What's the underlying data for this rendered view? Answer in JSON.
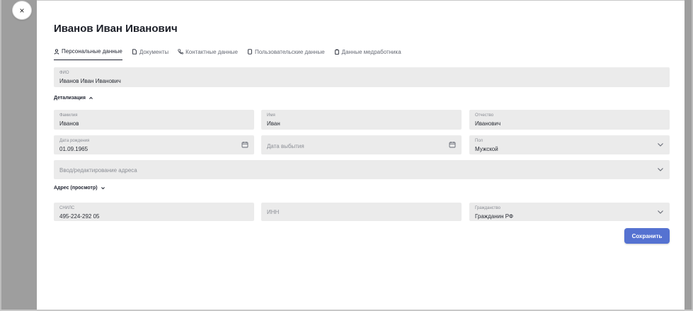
{
  "close_label": "×",
  "title": "Иванов Иван Иванович",
  "tabs": [
    {
      "label": "Персональные данные",
      "icon": "person-icon"
    },
    {
      "label": "Документы",
      "icon": "document-icon"
    },
    {
      "label": "Контактные данные",
      "icon": "phone-icon"
    },
    {
      "label": "Пользовательские данные",
      "icon": "page-icon"
    },
    {
      "label": "Данные медработника",
      "icon": "clipboard-icon"
    }
  ],
  "fio": {
    "label": "ФИО",
    "value": "Иванов Иван Иванович"
  },
  "detail_section": {
    "label": "Детализация",
    "icon": "chevron-up-icon"
  },
  "surname": {
    "label": "Фамилия",
    "value": "Иванов"
  },
  "name": {
    "label": "Имя",
    "value": "Иван"
  },
  "patronymic": {
    "label": "Отчество",
    "value": "Иванович"
  },
  "birth_date": {
    "label": "Дата рождения",
    "value": "01.09.1965",
    "icon": "calendar-icon"
  },
  "departure_date": {
    "placeholder": "Дата выбытия",
    "icon": "calendar-icon"
  },
  "gender": {
    "label": "Пол",
    "value": "Мужской",
    "icon": "chevron-down-icon"
  },
  "address_edit": {
    "placeholder": "Ввод/редактирование адреса",
    "icon": "chevron-down-icon"
  },
  "address_view_section": {
    "label": "Адрес (просмотр)",
    "icon": "chevron-down-icon"
  },
  "snils": {
    "label": "СНИЛС",
    "value": "495-224-292 05"
  },
  "inn": {
    "placeholder": "ИНН"
  },
  "citizenship": {
    "label": "Гражданство",
    "value": "Гражданин РФ",
    "icon": "chevron-down-icon"
  },
  "save_label": "Сохранить",
  "colors": {
    "accent": "#5572d1",
    "field_bg": "#ebebeb",
    "frame": "#9e9e9e"
  }
}
